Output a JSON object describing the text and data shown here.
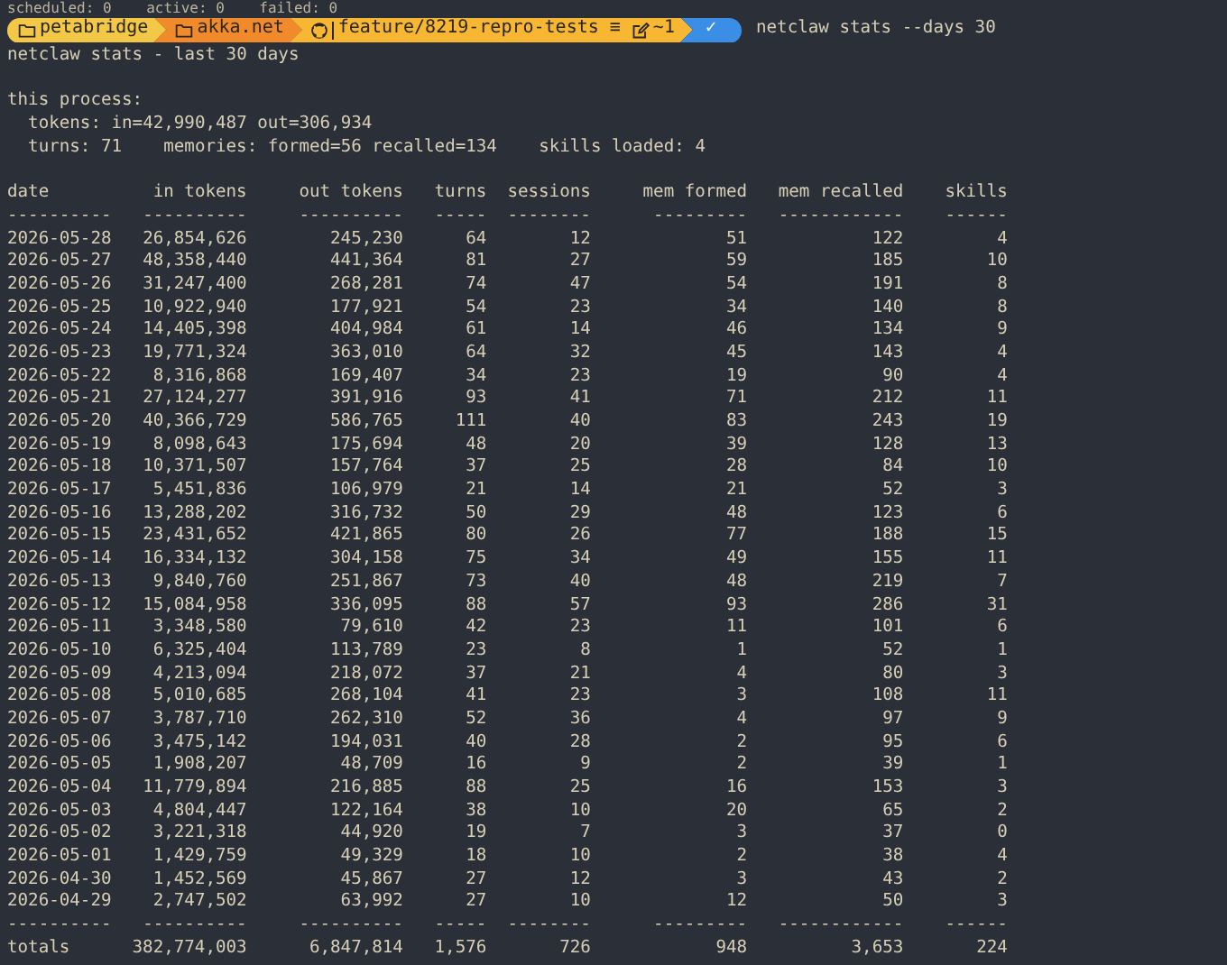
{
  "previous_line": "scheduled: 0    active: 0    failed: 0",
  "prompt": {
    "segments": [
      {
        "kind": "folder",
        "text": "petabridge",
        "color": "#f3c846"
      },
      {
        "kind": "folder",
        "text": "akka.net",
        "color": "#f18a2a"
      },
      {
        "kind": "git",
        "text": "feature/8219-repro-tests",
        "stash": "≡",
        "changes": "~1",
        "color": "#f7b733"
      },
      {
        "kind": "status",
        "text": "✓",
        "color": "#3a8ee6"
      }
    ],
    "command": "netclaw stats --days 30"
  },
  "output_title": "netclaw stats - last 30 days",
  "process": {
    "heading": "this process:",
    "tokens": "tokens: in=42,990,487 out=306,934",
    "turns": "turns: 71",
    "memories": "memories: formed=56 recalled=134",
    "skills": "skills loaded: 4"
  },
  "table": {
    "columns": [
      {
        "label": "date",
        "rule": "----------"
      },
      {
        "label": "in tokens",
        "rule": "----------"
      },
      {
        "label": "out tokens",
        "rule": "----------"
      },
      {
        "label": "turns",
        "rule": "-----"
      },
      {
        "label": "sessions",
        "rule": "--------"
      },
      {
        "label": "mem formed",
        "rule": "---------"
      },
      {
        "label": "mem recalled",
        "rule": "------------"
      },
      {
        "label": "skills",
        "rule": "------"
      }
    ],
    "rows": [
      [
        "2026-05-28",
        "26,854,626",
        "245,230",
        "64",
        "12",
        "51",
        "122",
        "4"
      ],
      [
        "2026-05-27",
        "48,358,440",
        "441,364",
        "81",
        "27",
        "59",
        "185",
        "10"
      ],
      [
        "2026-05-26",
        "31,247,400",
        "268,281",
        "74",
        "47",
        "54",
        "191",
        "8"
      ],
      [
        "2026-05-25",
        "10,922,940",
        "177,921",
        "54",
        "23",
        "34",
        "140",
        "8"
      ],
      [
        "2026-05-24",
        "14,405,398",
        "404,984",
        "61",
        "14",
        "46",
        "134",
        "9"
      ],
      [
        "2026-05-23",
        "19,771,324",
        "363,010",
        "64",
        "32",
        "45",
        "143",
        "4"
      ],
      [
        "2026-05-22",
        "8,316,868",
        "169,407",
        "34",
        "23",
        "19",
        "90",
        "4"
      ],
      [
        "2026-05-21",
        "27,124,277",
        "391,916",
        "93",
        "41",
        "71",
        "212",
        "11"
      ],
      [
        "2026-05-20",
        "40,366,729",
        "586,765",
        "111",
        "40",
        "83",
        "243",
        "19"
      ],
      [
        "2026-05-19",
        "8,098,643",
        "175,694",
        "48",
        "20",
        "39",
        "128",
        "13"
      ],
      [
        "2026-05-18",
        "10,371,507",
        "157,764",
        "37",
        "25",
        "28",
        "84",
        "10"
      ],
      [
        "2026-05-17",
        "5,451,836",
        "106,979",
        "21",
        "14",
        "21",
        "52",
        "3"
      ],
      [
        "2026-05-16",
        "13,288,202",
        "316,732",
        "50",
        "29",
        "48",
        "123",
        "6"
      ],
      [
        "2026-05-15",
        "23,431,652",
        "421,865",
        "80",
        "26",
        "77",
        "188",
        "15"
      ],
      [
        "2026-05-14",
        "16,334,132",
        "304,158",
        "75",
        "34",
        "49",
        "155",
        "11"
      ],
      [
        "2026-05-13",
        "9,840,760",
        "251,867",
        "73",
        "40",
        "48",
        "219",
        "7"
      ],
      [
        "2026-05-12",
        "15,084,958",
        "336,095",
        "88",
        "57",
        "93",
        "286",
        "31"
      ],
      [
        "2026-05-11",
        "3,348,580",
        "79,610",
        "42",
        "23",
        "11",
        "101",
        "6"
      ],
      [
        "2026-05-10",
        "6,325,404",
        "113,789",
        "23",
        "8",
        "1",
        "52",
        "1"
      ],
      [
        "2026-05-09",
        "4,213,094",
        "218,072",
        "37",
        "21",
        "4",
        "80",
        "3"
      ],
      [
        "2026-05-08",
        "5,010,685",
        "268,104",
        "41",
        "23",
        "3",
        "108",
        "11"
      ],
      [
        "2026-05-07",
        "3,787,710",
        "262,310",
        "52",
        "36",
        "4",
        "97",
        "9"
      ],
      [
        "2026-05-06",
        "3,475,142",
        "194,031",
        "40",
        "28",
        "2",
        "95",
        "6"
      ],
      [
        "2026-05-05",
        "1,908,207",
        "48,709",
        "16",
        "9",
        "2",
        "39",
        "1"
      ],
      [
        "2026-05-04",
        "11,779,894",
        "216,885",
        "88",
        "25",
        "16",
        "153",
        "3"
      ],
      [
        "2026-05-03",
        "4,804,447",
        "122,164",
        "38",
        "10",
        "20",
        "65",
        "2"
      ],
      [
        "2026-05-02",
        "3,221,318",
        "44,920",
        "19",
        "7",
        "3",
        "37",
        "0"
      ],
      [
        "2026-05-01",
        "1,429,759",
        "49,329",
        "18",
        "10",
        "2",
        "38",
        "4"
      ],
      [
        "2026-04-30",
        "1,452,569",
        "45,867",
        "27",
        "12",
        "3",
        "43",
        "2"
      ],
      [
        "2026-04-29",
        "2,747,502",
        "63,992",
        "27",
        "10",
        "12",
        "50",
        "3"
      ]
    ],
    "bottom_rules": [
      "----------",
      "----------",
      "----------",
      "-----",
      "--------",
      "---------",
      "------------",
      "------"
    ],
    "totals": [
      "totals",
      "382,774,003",
      "6,847,814",
      "1,576",
      "726",
      "948",
      "3,653",
      "224"
    ]
  }
}
